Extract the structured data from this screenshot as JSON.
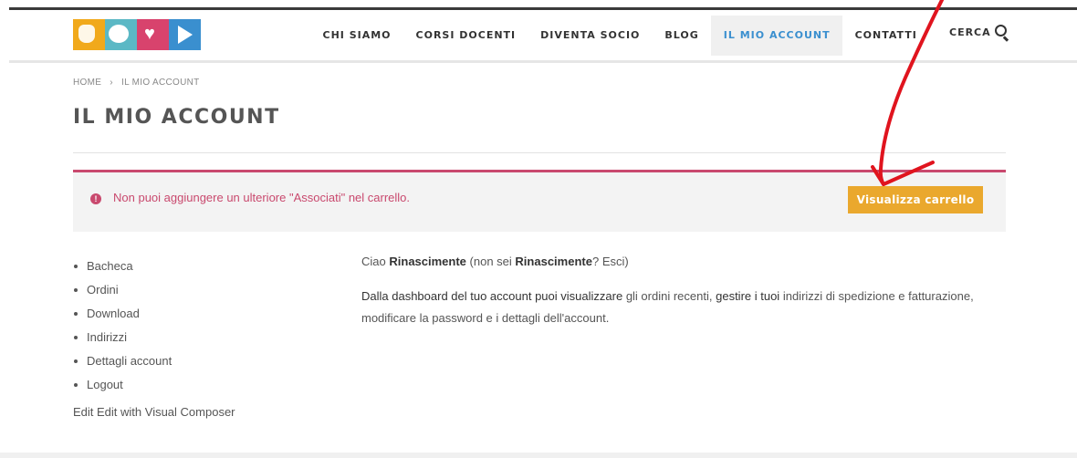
{
  "header": {
    "nav": [
      {
        "label": "CHI SIAMO",
        "active": false
      },
      {
        "label": "CORSI DOCENTI",
        "active": false
      },
      {
        "label": "DIVENTA SOCIO",
        "active": false
      },
      {
        "label": "BLOG",
        "active": false
      },
      {
        "label": "IL MIO ACCOUNT",
        "active": true
      },
      {
        "label": "CONTATTI",
        "active": false
      }
    ],
    "search_label": "CERCA",
    "logo_icons": [
      "hand-icon",
      "speech-bubble-icon",
      "heart-icon",
      "play-icon"
    ]
  },
  "breadcrumb": {
    "home": "HOME",
    "separator": "›",
    "current": "IL MIO ACCOUNT"
  },
  "page_title": "IL MIO ACCOUNT",
  "notice": {
    "icon": "exclamation-icon",
    "text": "Non puoi aggiungere un ulteriore \"Associati\" nel carrello.",
    "button": "Visualizza carrello"
  },
  "account_menu": [
    "Bacheca",
    "Ordini",
    "Download",
    "Indirizzi",
    "Dettagli account",
    "Logout"
  ],
  "edit_link": "Edit Edit with Visual Composer",
  "greeting": {
    "ciao": "Ciao",
    "name": "Rinascimente",
    "not_you_open": "(non sei",
    "not_you_name": "Rinascimente",
    "not_you_close": "?",
    "logout": "Esci",
    "paren_close": ")"
  },
  "dashboard_text": {
    "part1": "Dalla dashboard del tuo account puoi visualizzare",
    "link1": "gli ordini recenti",
    "part2": ",",
    "link2_prefix": "gestire i tuoi",
    "link2": "indirizzi di spedizione e fatturazione",
    "part3": ",",
    "link3": "modificare la password e i dettagli dell'account",
    "part4": "."
  },
  "colors": {
    "active_nav": "#3a8fcf",
    "notice_accent": "#c9496e",
    "button": "#eaa82d",
    "annotation_arrow": "#e0141e"
  }
}
